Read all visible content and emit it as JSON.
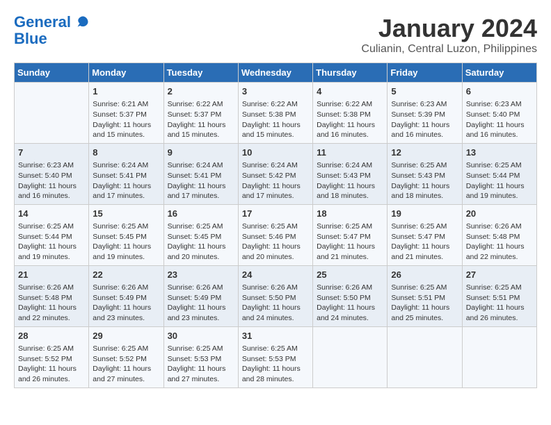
{
  "header": {
    "logo_line1": "General",
    "logo_line2": "Blue",
    "month_year": "January 2024",
    "location": "Culianin, Central Luzon, Philippines"
  },
  "days_of_week": [
    "Sunday",
    "Monday",
    "Tuesday",
    "Wednesday",
    "Thursday",
    "Friday",
    "Saturday"
  ],
  "weeks": [
    [
      {
        "day": "",
        "info": ""
      },
      {
        "day": "1",
        "info": "Sunrise: 6:21 AM\nSunset: 5:37 PM\nDaylight: 11 hours\nand 15 minutes."
      },
      {
        "day": "2",
        "info": "Sunrise: 6:22 AM\nSunset: 5:37 PM\nDaylight: 11 hours\nand 15 minutes."
      },
      {
        "day": "3",
        "info": "Sunrise: 6:22 AM\nSunset: 5:38 PM\nDaylight: 11 hours\nand 15 minutes."
      },
      {
        "day": "4",
        "info": "Sunrise: 6:22 AM\nSunset: 5:38 PM\nDaylight: 11 hours\nand 16 minutes."
      },
      {
        "day": "5",
        "info": "Sunrise: 6:23 AM\nSunset: 5:39 PM\nDaylight: 11 hours\nand 16 minutes."
      },
      {
        "day": "6",
        "info": "Sunrise: 6:23 AM\nSunset: 5:40 PM\nDaylight: 11 hours\nand 16 minutes."
      }
    ],
    [
      {
        "day": "7",
        "info": "Sunrise: 6:23 AM\nSunset: 5:40 PM\nDaylight: 11 hours\nand 16 minutes."
      },
      {
        "day": "8",
        "info": "Sunrise: 6:24 AM\nSunset: 5:41 PM\nDaylight: 11 hours\nand 17 minutes."
      },
      {
        "day": "9",
        "info": "Sunrise: 6:24 AM\nSunset: 5:41 PM\nDaylight: 11 hours\nand 17 minutes."
      },
      {
        "day": "10",
        "info": "Sunrise: 6:24 AM\nSunset: 5:42 PM\nDaylight: 11 hours\nand 17 minutes."
      },
      {
        "day": "11",
        "info": "Sunrise: 6:24 AM\nSunset: 5:43 PM\nDaylight: 11 hours\nand 18 minutes."
      },
      {
        "day": "12",
        "info": "Sunrise: 6:25 AM\nSunset: 5:43 PM\nDaylight: 11 hours\nand 18 minutes."
      },
      {
        "day": "13",
        "info": "Sunrise: 6:25 AM\nSunset: 5:44 PM\nDaylight: 11 hours\nand 19 minutes."
      }
    ],
    [
      {
        "day": "14",
        "info": "Sunrise: 6:25 AM\nSunset: 5:44 PM\nDaylight: 11 hours\nand 19 minutes."
      },
      {
        "day": "15",
        "info": "Sunrise: 6:25 AM\nSunset: 5:45 PM\nDaylight: 11 hours\nand 19 minutes."
      },
      {
        "day": "16",
        "info": "Sunrise: 6:25 AM\nSunset: 5:45 PM\nDaylight: 11 hours\nand 20 minutes."
      },
      {
        "day": "17",
        "info": "Sunrise: 6:25 AM\nSunset: 5:46 PM\nDaylight: 11 hours\nand 20 minutes."
      },
      {
        "day": "18",
        "info": "Sunrise: 6:25 AM\nSunset: 5:47 PM\nDaylight: 11 hours\nand 21 minutes."
      },
      {
        "day": "19",
        "info": "Sunrise: 6:25 AM\nSunset: 5:47 PM\nDaylight: 11 hours\nand 21 minutes."
      },
      {
        "day": "20",
        "info": "Sunrise: 6:26 AM\nSunset: 5:48 PM\nDaylight: 11 hours\nand 22 minutes."
      }
    ],
    [
      {
        "day": "21",
        "info": "Sunrise: 6:26 AM\nSunset: 5:48 PM\nDaylight: 11 hours\nand 22 minutes."
      },
      {
        "day": "22",
        "info": "Sunrise: 6:26 AM\nSunset: 5:49 PM\nDaylight: 11 hours\nand 23 minutes."
      },
      {
        "day": "23",
        "info": "Sunrise: 6:26 AM\nSunset: 5:49 PM\nDaylight: 11 hours\nand 23 minutes."
      },
      {
        "day": "24",
        "info": "Sunrise: 6:26 AM\nSunset: 5:50 PM\nDaylight: 11 hours\nand 24 minutes."
      },
      {
        "day": "25",
        "info": "Sunrise: 6:26 AM\nSunset: 5:50 PM\nDaylight: 11 hours\nand 24 minutes."
      },
      {
        "day": "26",
        "info": "Sunrise: 6:25 AM\nSunset: 5:51 PM\nDaylight: 11 hours\nand 25 minutes."
      },
      {
        "day": "27",
        "info": "Sunrise: 6:25 AM\nSunset: 5:51 PM\nDaylight: 11 hours\nand 26 minutes."
      }
    ],
    [
      {
        "day": "28",
        "info": "Sunrise: 6:25 AM\nSunset: 5:52 PM\nDaylight: 11 hours\nand 26 minutes."
      },
      {
        "day": "29",
        "info": "Sunrise: 6:25 AM\nSunset: 5:52 PM\nDaylight: 11 hours\nand 27 minutes."
      },
      {
        "day": "30",
        "info": "Sunrise: 6:25 AM\nSunset: 5:53 PM\nDaylight: 11 hours\nand 27 minutes."
      },
      {
        "day": "31",
        "info": "Sunrise: 6:25 AM\nSunset: 5:53 PM\nDaylight: 11 hours\nand 28 minutes."
      },
      {
        "day": "",
        "info": ""
      },
      {
        "day": "",
        "info": ""
      },
      {
        "day": "",
        "info": ""
      }
    ]
  ]
}
